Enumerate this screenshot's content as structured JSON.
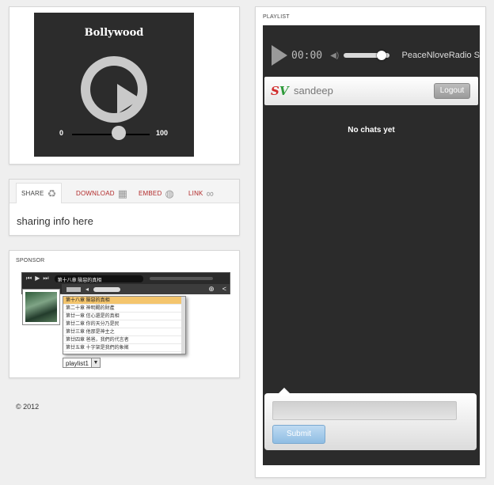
{
  "player": {
    "title": "Bollywood",
    "volume_min": "0",
    "volume_max": "100",
    "volume_level": 0.6
  },
  "share": {
    "tabs": [
      {
        "label": "SHARE",
        "icon": "recycle-icon"
      },
      {
        "label": "DOWNLOAD",
        "icon": "film-icon"
      },
      {
        "label": "EMBED",
        "icon": "globe-icon"
      },
      {
        "label": "LINK",
        "icon": "link-icon"
      }
    ],
    "content": "sharing info here"
  },
  "sponsor": {
    "heading": "SPONSOR",
    "now_playing": "第十八章 險惡的真相",
    "playlist": [
      "第十八章 險惡的真相",
      "第二十章 神明賜的財產",
      "第廿一章 信心還是的真相",
      "第廿二章 你的天分乃是民",
      "第廿三章 他那是神主之",
      "第廿四章 爸爸，我們的代言者",
      "第廿五章 十字架是我們的象徵"
    ],
    "select_value": "playlist1"
  },
  "footer": {
    "copyright": "© 2012"
  },
  "right_panel": {
    "heading": "PLAYLIST",
    "time": "00:00",
    "station": "PeaceNloveRadio S",
    "volume_level": 0.8,
    "username": "sandeep",
    "logout_label": "Logout",
    "empty_message": "No chats yet",
    "input_placeholder": "",
    "submit_label": "Submit"
  },
  "colors": {
    "player_bg": "#2c2c2c",
    "tab_red": "#b22a2a",
    "playlist_highlight": "#f4c56d",
    "submit_blue": "#8fbde3"
  }
}
